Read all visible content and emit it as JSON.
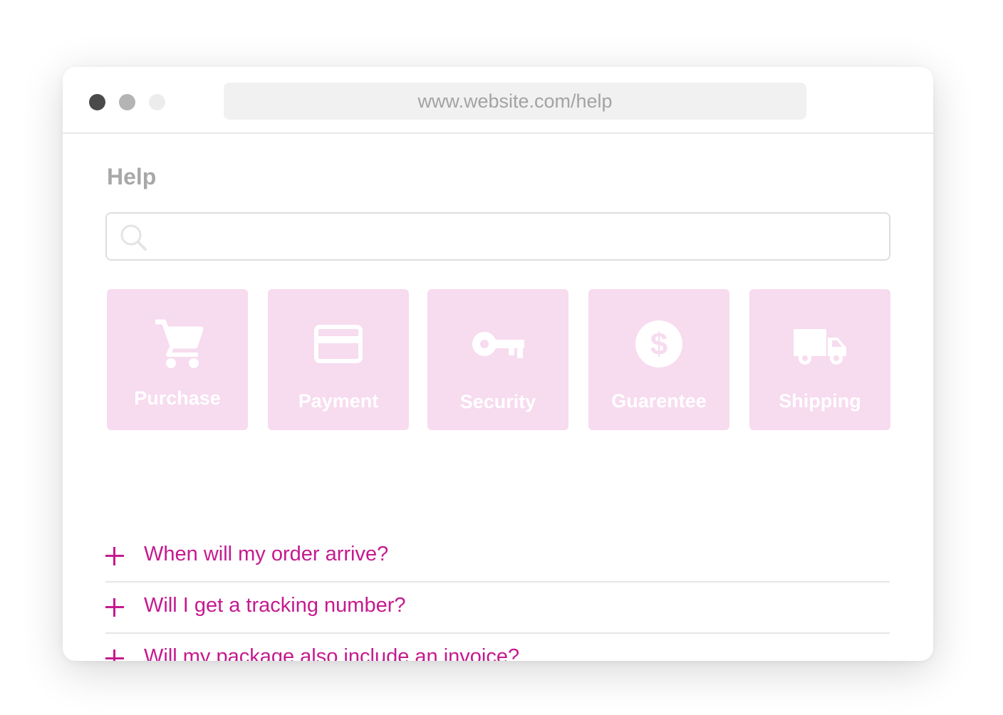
{
  "browser": {
    "url": "www.website.com/help",
    "window_controls": [
      "close",
      "minimize",
      "maximize"
    ]
  },
  "page": {
    "title": "Help",
    "search": {
      "icon": "search-icon",
      "value": "",
      "placeholder": ""
    },
    "categories": [
      {
        "label": "Purchase",
        "icon": "shopping-cart-icon"
      },
      {
        "label": "Payment",
        "icon": "credit-card-icon"
      },
      {
        "label": "Security",
        "icon": "key-icon"
      },
      {
        "label": "Guarentee",
        "icon": "dollar-circle-icon"
      },
      {
        "label": "Shipping",
        "icon": "truck-icon"
      }
    ],
    "faq": [
      {
        "question": "When will my order arrive?",
        "icon": "plus-icon"
      },
      {
        "question": "Will I get a tracking number?",
        "icon": "plus-icon"
      },
      {
        "question": "Will my package also include an invoice?",
        "icon": "plus-icon"
      }
    ]
  },
  "colors": {
    "accent": "#c51a8f",
    "tile_background": "#f7dbef",
    "title_gray": "#a8a8a8"
  }
}
